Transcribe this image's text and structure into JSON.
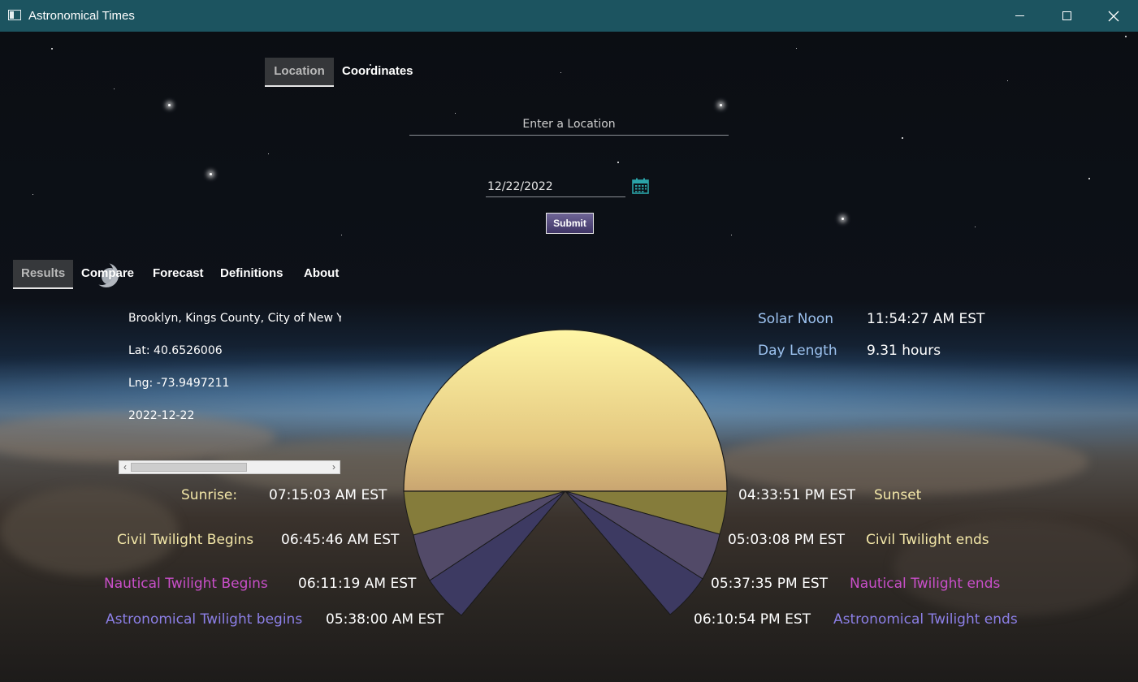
{
  "window": {
    "title": "Astronomical Times"
  },
  "input_tabs": [
    {
      "label": "Location",
      "active": true
    },
    {
      "label": "Coordinates",
      "active": false
    }
  ],
  "location_input": {
    "placeholder": "Enter a Location",
    "value": ""
  },
  "date_input": {
    "value": "12/22/2022"
  },
  "submit_label": "Submit",
  "result_tabs": [
    {
      "label": "Results",
      "active": true
    },
    {
      "label": "Compare",
      "active": false
    },
    {
      "label": "Forecast",
      "active": false
    },
    {
      "label": "Definitions",
      "active": false
    },
    {
      "label": "About",
      "active": false
    }
  ],
  "place": {
    "name": "Brooklyn, Kings County, City of New York",
    "lat": "Lat: 40.6526006",
    "lng": "Lng: -73.9497211",
    "date": "2022-12-22"
  },
  "summary": {
    "solar_noon_label": "Solar Noon",
    "solar_noon_value": "11:54:27 AM EST",
    "day_length_label": "Day Length",
    "day_length_value": "9.31 hours"
  },
  "events": {
    "sunrise_label": "Sunrise:",
    "sunrise_time": "07:15:03 AM EST",
    "civil_begin_label": "Civil Twilight Begins",
    "civil_begin_time": "06:45:46 AM EST",
    "nautical_begin_label": "Nautical Twilight Begins",
    "nautical_begin_time": "06:11:19 AM EST",
    "astro_begin_label": "Astronomical Twilight begins",
    "astro_begin_time": "05:38:00 AM EST",
    "sunset_label": "Sunset",
    "sunset_time": "04:33:51 PM EST",
    "civil_end_label": "Civil Twilight ends",
    "civil_end_time": "05:03:08 PM EST",
    "nautical_end_label": "Nautical Twilight ends",
    "nautical_end_time": "05:37:35 PM EST",
    "astro_end_label": "Astronomical Twilight ends",
    "astro_end_time": "06:10:54 PM EST"
  },
  "colors": {
    "titlebar": "#1c5460",
    "daylight": "#f3e29a",
    "civil": "#7f7a3a",
    "nautical": "#4b4563",
    "astronomical": "#3b3a5e",
    "accent_blue": "#9dc3f0",
    "accent_magenta": "#c94fc9",
    "accent_purple": "#8c7fe6"
  },
  "icons": [
    "app-icon",
    "minimize-icon",
    "maximize-icon",
    "close-icon",
    "calendar-icon",
    "moon-icon",
    "chevron-left-icon",
    "chevron-right-icon"
  ]
}
